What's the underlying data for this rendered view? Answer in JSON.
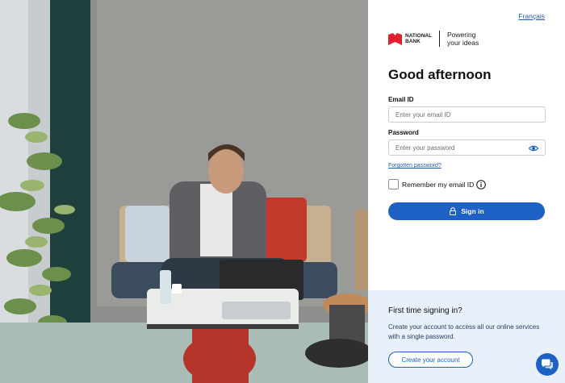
{
  "language_link": "Français",
  "brand": {
    "name": "NATIONAL BANK",
    "tagline": "Powering your ideas",
    "logo_color": "#e4202e"
  },
  "greeting": "Good afternoon",
  "email": {
    "label": "Email ID",
    "placeholder": "Enter your email ID",
    "value": ""
  },
  "password": {
    "label": "Password",
    "placeholder": "Enter your password",
    "value": "",
    "toggle_icon": "eye-icon"
  },
  "forgot_link": "Forgotten password?",
  "remember": {
    "label": "Remember my email ID",
    "checked": false,
    "info_icon": "info-icon"
  },
  "signin_button": {
    "label": "Sign in",
    "icon": "lock-icon"
  },
  "first_time": {
    "title": "First time signing in?",
    "description": "Create your account to access all our online services with a single password.",
    "button_label": "Create your account"
  },
  "chat_icon": "chat-icon",
  "colors": {
    "primary": "#1e61c4",
    "link": "#2159a8",
    "first_time_bg": "#e8f1fb",
    "logo_red": "#e4202e"
  }
}
